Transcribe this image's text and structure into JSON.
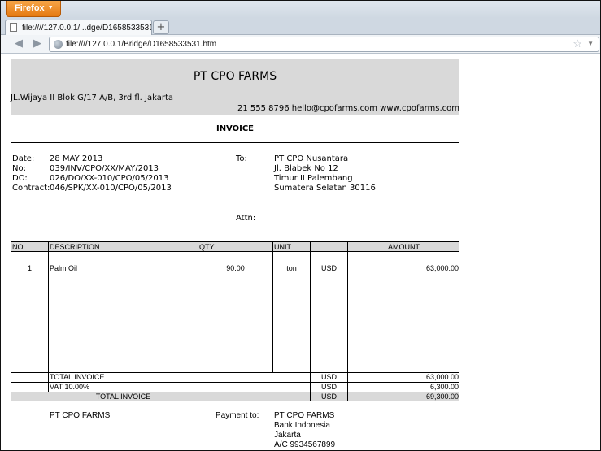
{
  "browser": {
    "menu_label": "Firefox",
    "tab_title": "file:////127.0.0.1/...dge/D1658533531.htm",
    "new_tab": "+",
    "url": "file:////127.0.0.1/Bridge/D1658533531.htm"
  },
  "invoice": {
    "company": "PT CPO FARMS",
    "address": "JL.Wijaya II Blok G/17 A/B, 3rd fl. Jakarta",
    "contact": "21 555 8796 hello@cpofarms.com www.cpofarms.com",
    "title": "INVOICE",
    "details": {
      "date_label": "Date:",
      "date": "28 MAY 2013",
      "no_label": "No:",
      "no": "039/INV/CPO/XX/MAY/2013",
      "do_label": "DO:",
      "do": "026/DO/XX-010/CPO/05/2013",
      "contract_label": "Contract:",
      "contract": "046/SPK/XX-010/CPO/05/2013"
    },
    "recipient": {
      "to_label": "To:",
      "line1": "PT CPO Nusantara",
      "line2": "Jl. Blabek No 12",
      "line3": "Timur II Palembang",
      "line4": "Sumatera Selatan 30116",
      "attn_label": "Attn:"
    },
    "columns": {
      "no": "NO.",
      "description": "DESCRIPTION",
      "qty": "QTY",
      "unit": "UNIT",
      "amount": "AMOUNT"
    },
    "item": {
      "no": "1",
      "description": "Palm Oil",
      "qty": "90.00",
      "unit": "ton",
      "currency": "USD",
      "amount": "63,000.00"
    },
    "totals": {
      "subtotal_label": "TOTAL INVOICE",
      "subtotal_currency": "USD",
      "subtotal": "63,000.00",
      "vat_label": "VAT 10.00%",
      "vat_currency": "USD",
      "vat": "6,300.00",
      "grand_label": "TOTAL INVOICE",
      "grand_currency": "USD",
      "grand": "69,300.00"
    },
    "footer": {
      "company": "PT CPO FARMS",
      "payment_label": "Payment to:",
      "payee": "PT CPO FARMS",
      "bank": "Bank Indonesia",
      "city": "Jakarta",
      "account": "A/C 9934567899"
    }
  }
}
